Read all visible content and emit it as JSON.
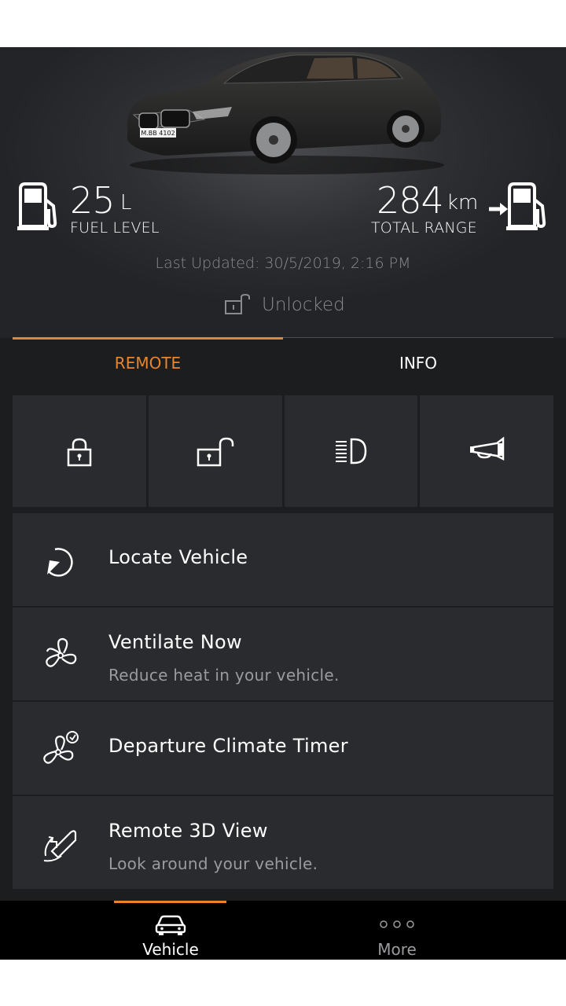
{
  "fuel": {
    "value": "25",
    "unit": "L",
    "label": "FUEL LEVEL"
  },
  "range": {
    "value": "284",
    "unit": "km",
    "label": "TOTAL RANGE"
  },
  "last_updated": "Last Updated: 30/5/2019, 2:16 PM",
  "lock_status": "Unlocked",
  "tabs": [
    {
      "label": "REMOTE",
      "active": true
    },
    {
      "label": "INFO",
      "active": false
    }
  ],
  "remote_actions": [
    {
      "icon": "lock-icon"
    },
    {
      "icon": "unlock-icon"
    },
    {
      "icon": "headlight-icon"
    },
    {
      "icon": "horn-icon"
    }
  ],
  "list": [
    {
      "icon": "locate-icon",
      "title": "Locate Vehicle",
      "subtitle": ""
    },
    {
      "icon": "fan-icon",
      "title": "Ventilate Now",
      "subtitle": "Reduce heat in your vehicle."
    },
    {
      "icon": "fan-timer-icon",
      "title": "Departure Climate Timer",
      "subtitle": ""
    },
    {
      "icon": "3d-view-icon",
      "title": "Remote 3D View",
      "subtitle": "Look around your vehicle."
    }
  ],
  "car_plate": "M.BB 4102",
  "bottom_nav": [
    {
      "label": "Vehicle",
      "icon": "car-icon",
      "active": true
    },
    {
      "label": "More",
      "icon": "more-dots-icon",
      "active": false
    }
  ],
  "colors": {
    "accent": "#e8852c",
    "background": "#1c1d1f",
    "card": "#2a2b2e"
  }
}
